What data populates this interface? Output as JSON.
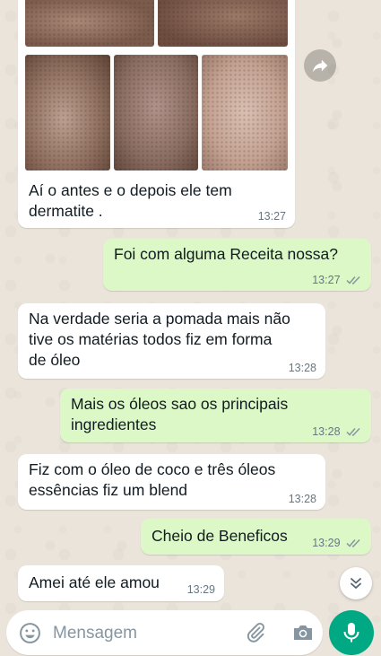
{
  "chat": {
    "messages": [
      {
        "direction": "in",
        "type": "image",
        "caption": "Aí o antes e o depois ele tem\ndermatite .",
        "time": "13:27"
      },
      {
        "direction": "out",
        "text": "Foi com alguma Receita nossa?",
        "time": "13:27",
        "status": "read"
      },
      {
        "direction": "in",
        "text": "Na verdade seria a pomada mais não\ntive os matérias todos fiz em forma\nde óleo",
        "time": "13:28"
      },
      {
        "direction": "out",
        "text": "Mais os óleos sao os principais\ningredientes",
        "time": "13:28",
        "status": "read"
      },
      {
        "direction": "in",
        "text": "Fiz com o óleo de coco e três óleos\nessências fiz um blend",
        "time": "13:28"
      },
      {
        "direction": "out",
        "text": "Cheio de Beneficos",
        "time": "13:29",
        "status": "read"
      },
      {
        "direction": "in",
        "text": "Amei até ele amou",
        "time": "13:29"
      }
    ]
  },
  "composer": {
    "placeholder": "Mensagem",
    "icons": [
      "emoji-icon",
      "attach-icon",
      "camera-icon",
      "mic-icon"
    ]
  },
  "icons": {
    "forward": "forward-icon",
    "scroll_down": "double-chevron-down-icon",
    "read_receipt": "double-check-icon"
  },
  "colors": {
    "incoming_bubble": "#ffffff",
    "outgoing_bubble": "#dcf8c6",
    "accent": "#00a884",
    "read_ticks": "#8696a0",
    "wallpaper": "#ebe4da"
  }
}
